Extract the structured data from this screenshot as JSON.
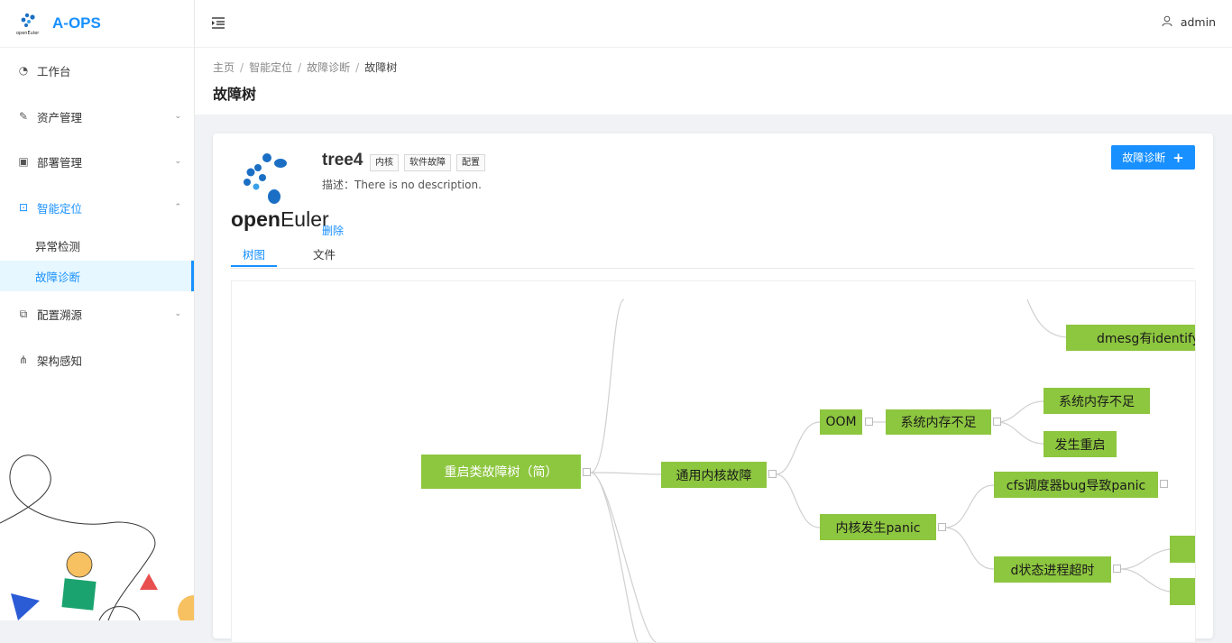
{
  "app": {
    "logo_small_text": "openEuler",
    "title": "A-OPS",
    "accent": "#1890ff",
    "node_color": "#8dc63f"
  },
  "sidebar": {
    "menu": [
      {
        "label": "工作台",
        "icon": "dashboard-icon"
      },
      {
        "label": "资产管理",
        "icon": "edit-icon",
        "arrow": "⌄"
      },
      {
        "label": "部署管理",
        "icon": "deploy-icon",
        "arrow": "⌄"
      },
      {
        "label": "智能定位",
        "icon": "lock-icon",
        "arrow": "⌃"
      },
      {
        "label": "配置溯源",
        "icon": "cluster-icon",
        "arrow": "⌄"
      },
      {
        "label": "架构感知",
        "icon": "network-icon"
      }
    ],
    "submenu": [
      {
        "label": "异常检测"
      },
      {
        "label": "故障诊断"
      }
    ]
  },
  "header": {
    "user": "admin"
  },
  "breadcrumb": [
    "主页",
    "智能定位",
    "故障诊断",
    "故障树"
  ],
  "page_title": "故障树",
  "tree": {
    "logo_text_bold": "open",
    "logo_text_light": "Euler",
    "name": "tree4",
    "tags": [
      "内核",
      "软件故障",
      "配置"
    ],
    "desc": "描述：There is no description.",
    "delete_label": "删除",
    "diagnose_button": "故障诊断",
    "diagnose_plus": "+",
    "tabs": [
      "树图",
      "文件"
    ]
  },
  "mindmap": {
    "root": "重启类故障树（简）",
    "n1": "通用内核故障",
    "n_oom": "OOM",
    "n_sysmem": "系统内存不足",
    "n_sysmem2": "系统内存不足",
    "n_reboot": "发生重启",
    "n_panic": "内核发生panic",
    "n_cfs": "cfs调度器bug导致panic",
    "n_dstate": "d状态进程超时",
    "n_dmesg": "dmesg有identify"
  }
}
